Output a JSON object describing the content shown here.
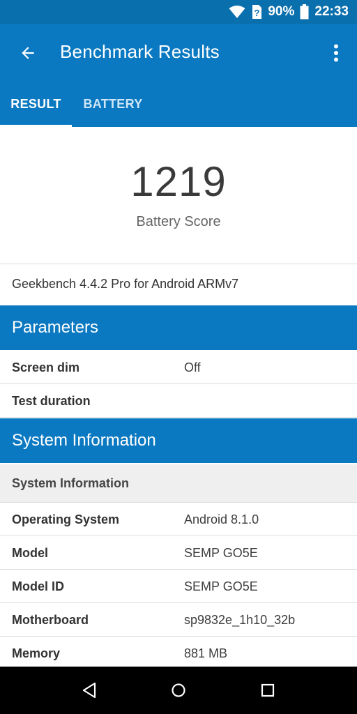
{
  "status_bar": {
    "battery_percent": "90%",
    "time": "22:33"
  },
  "app_bar": {
    "title": "Benchmark Results"
  },
  "tabs": [
    {
      "label": "RESULT",
      "selected": true
    },
    {
      "label": "BATTERY",
      "selected": false
    }
  ],
  "score": {
    "value": "1219",
    "label": "Battery Score"
  },
  "version": "Geekbench 4.4.2 Pro for Android ARMv7",
  "parameters": {
    "header": "Parameters",
    "rows": [
      {
        "key": "Screen dim",
        "value": "Off"
      },
      {
        "key": "Test duration",
        "value": ""
      }
    ]
  },
  "system_information": {
    "header": "System Information",
    "subheader": "System Information",
    "rows": [
      {
        "key": "Operating System",
        "value": "Android 8.1.0"
      },
      {
        "key": "Model",
        "value": "SEMP GO5E"
      },
      {
        "key": "Model ID",
        "value": "SEMP GO5E"
      },
      {
        "key": "Motherboard",
        "value": "sp9832e_1h10_32b"
      },
      {
        "key": "Memory",
        "value": "881 MB"
      }
    ]
  },
  "colors": {
    "app_bar": "#0b79c1",
    "status_bar": "#0a6fad",
    "nav_bar": "#000000"
  },
  "icons": {
    "back": "arrow-back-icon",
    "overflow": "more-vert-icon",
    "wifi": "wifi-icon",
    "battery": "battery-icon",
    "nav_back": "nav-back-icon",
    "nav_home": "nav-home-icon",
    "nav_recents": "nav-recents-icon"
  }
}
